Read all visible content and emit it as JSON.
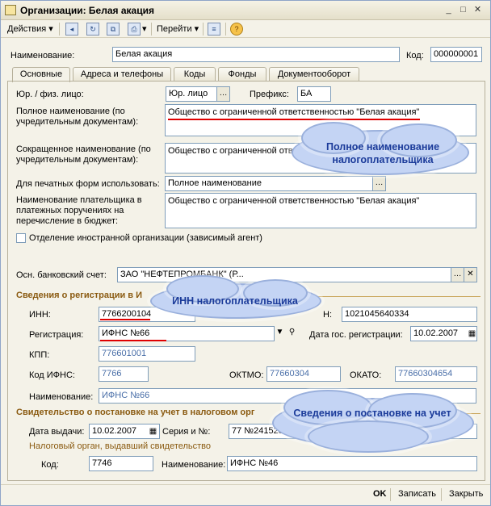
{
  "window": {
    "title": "Организации: Белая акация"
  },
  "toolbar": {
    "actions": "Действия",
    "goto": "Перейти"
  },
  "header": {
    "name_label": "Наименование:",
    "name_value": "Белая акация",
    "code_label": "Код:",
    "code_value": "000000001"
  },
  "tabs": [
    "Основные",
    "Адреса и телефоны",
    "Коды",
    "Фонды",
    "Документооборот"
  ],
  "main": {
    "legal_label": "Юр. / физ. лицо:",
    "legal_value": "Юр. лицо",
    "prefix_label": "Префикс:",
    "prefix_value": "БА",
    "full_name_label": "Полное наименование (по учредительным документам):",
    "full_name_value": "Общество с ограниченной ответственностью \"Белая акация\"",
    "short_name_label": "Сокращенное наименование (по учредительным документам):",
    "short_name_value": "Общество с ограниченной ответст",
    "print_label": "Для печатных форм использовать:",
    "print_value": "Полное наименование",
    "payer_label": "Наименование плательщика в платежных поручениях на перечисление в бюджет:",
    "payer_value": "Общество с ограниченной ответственностью \"Белая акация\"",
    "foreign_label": "Отделение иностранной организации (зависимый агент)",
    "bank_label": "Осн. банковский счет:",
    "bank_value": "ЗАО \"НЕФТЕПРОМБАНК\" (Р..."
  },
  "registration": {
    "section_title": "Сведения о регистрации в И",
    "inn_label": "ИНН:",
    "inn_value": "7766200104",
    "ogrn_label": "Н:",
    "ogrn_value": "1021045640334",
    "reg_label": "Регистрация:",
    "reg_value": "ИФНС №66",
    "regdate_label": "Дата гос. регистрации:",
    "regdate_value": "10.02.2007",
    "kpp_label": "КПП:",
    "kpp_value": "776601001",
    "ifns_label": "Код ИФНС:",
    "ifns_value": "7766",
    "oktmo_label": "ОКТМО:",
    "oktmo_value": "77660304",
    "okato_label": "ОКАТО:",
    "okato_value": "77660304654",
    "name_label": "Наименование:",
    "name_value": "ИФНС №66"
  },
  "certificate": {
    "section_title": "Свидетельство о постановке на учет в налоговом орг",
    "date_label": "Дата выдачи:",
    "date_value": "10.02.2007",
    "series_label": "Серия и №:",
    "series_value": "77 №241528",
    "issuer_label": "Налоговый орган, выдавший свидетельство",
    "code_label": "Код:",
    "code_value": "7746",
    "name_label": "Наименование:",
    "name_value": "ИФНС №46"
  },
  "callouts": {
    "c1": "Полное наименование налогоплательщика",
    "c2": "ИНН налогоплательщика",
    "c3": "Сведения о постановке на учет"
  },
  "buttons": {
    "ok": "OK",
    "write": "Записать",
    "close": "Закрыть"
  }
}
